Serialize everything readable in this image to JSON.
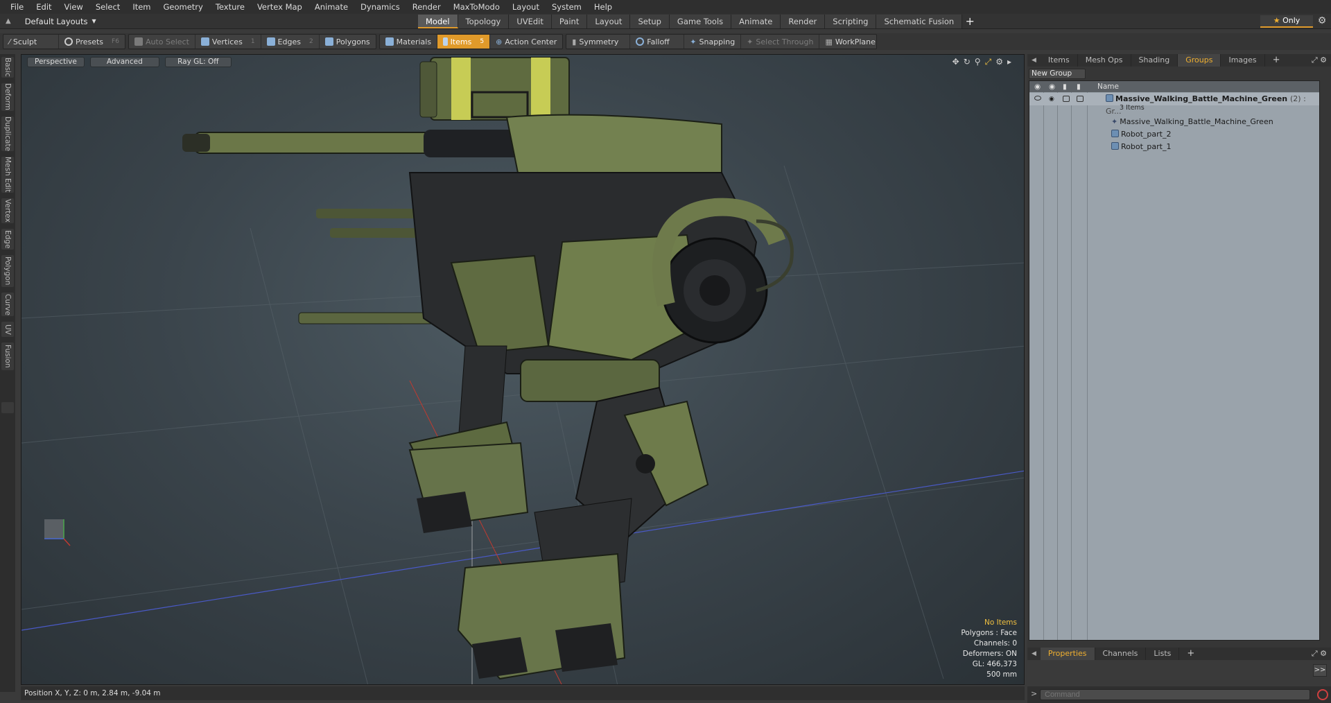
{
  "menu": [
    "File",
    "Edit",
    "View",
    "Select",
    "Item",
    "Geometry",
    "Texture",
    "Vertex Map",
    "Animate",
    "Dynamics",
    "Render",
    "MaxToModo",
    "Layout",
    "System",
    "Help"
  ],
  "layout": {
    "select_label": "Default Layouts",
    "only_label": "Only"
  },
  "tabs": [
    "Model",
    "Topology",
    "UVEdit",
    "Paint",
    "Layout",
    "Setup",
    "Game Tools",
    "Animate",
    "Render",
    "Scripting",
    "Schematic Fusion"
  ],
  "toolbar": {
    "sculpt": "Sculpt",
    "presets": "Presets",
    "presets_key": "F6",
    "auto_select": "Auto Select",
    "vertices": "Vertices",
    "vertices_key": "1",
    "edges": "Edges",
    "edges_key": "2",
    "polygons": "Polygons",
    "materials": "Materials",
    "items": "Items",
    "items_key": "5",
    "action_center": "Action Center",
    "symmetry": "Symmetry",
    "falloff": "Falloff",
    "snapping": "Snapping",
    "select_through": "Select Through",
    "workplane": "WorkPlane"
  },
  "left_tabs": [
    "Basic",
    "Deform",
    "Duplicate",
    "Mesh Edit",
    "Vertex",
    "Edge",
    "Polygon",
    "Curve",
    "UV",
    "Fusion"
  ],
  "viewport": {
    "view_mode": "Perspective",
    "shading": "Advanced",
    "raygl": "Ray GL: Off",
    "info": [
      "No Items",
      "Polygons : Face",
      "Channels: 0",
      "Deformers: ON",
      "GL: 466,373",
      "500 mm"
    ]
  },
  "status": "Position X, Y, Z:   0 m, 2.84 m, -9.04 m",
  "right_panel": {
    "tabs": [
      "Items",
      "Mesh Ops",
      "Shading",
      "Groups",
      "Images"
    ],
    "active_tab": "Groups",
    "new_group": "New Group",
    "name_header": "Name",
    "tree": {
      "group_name": "Massive_Walking_Battle_Machine_Green",
      "group_suffix": "(2) : Gr...",
      "item_count": "3 Items",
      "children": [
        "Massive_Walking_Battle_Machine_Green",
        "Robot_part_2",
        "Robot_part_1"
      ]
    },
    "bottom_tabs": [
      "Properties",
      "Channels",
      "Lists"
    ],
    "command_placeholder": "Command"
  }
}
